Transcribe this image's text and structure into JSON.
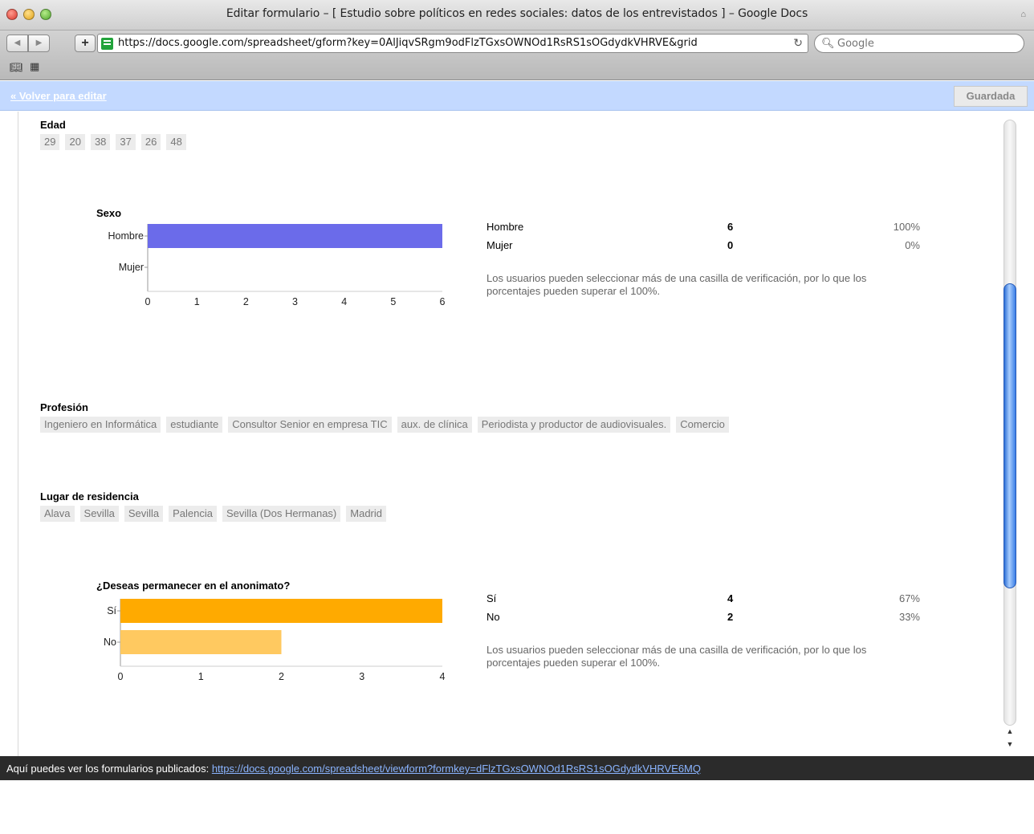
{
  "window": {
    "title": "Editar formulario – [ Estudio sobre políticos en redes sociales: datos de los entrevistados ] – Google Docs",
    "url": "https://docs.google.com/spreadsheet/gform?key=0AlJiqvSRgm9odFlzTGxsOWNOd1RsRS1sOGdydkVHRVE&grid",
    "search_placeholder": "Google",
    "icons": {
      "close": "close-light",
      "minimize": "minimize-light",
      "maximize": "maximize-light",
      "lock": "lock-icon",
      "reload": "reload-icon",
      "search": "search-icon",
      "bookmarks": "book-icon",
      "top_sites": "grid-icon"
    }
  },
  "appbar": {
    "back_link": "« Volver para editar",
    "saved_label": "Guardada",
    "color": "#c3d9ff"
  },
  "sections": {
    "edad": {
      "title": "Edad",
      "values": [
        "29",
        "20",
        "38",
        "37",
        "26",
        "48"
      ]
    },
    "profesion": {
      "title": "Profesión",
      "values": [
        "Ingeniero en Informática",
        "estudiante",
        "Consultor Senior en empresa TIC",
        "aux. de clínica",
        "Periodista y productor de audiovisuales.",
        "Comercio"
      ]
    },
    "residencia": {
      "title": "Lugar de residencia",
      "values": [
        "Alava",
        "Sevilla",
        "Sevilla",
        "Palencia",
        "Sevilla (Dos Hermanas)",
        "Madrid"
      ]
    }
  },
  "summaries": {
    "sexo": {
      "rows": [
        {
          "label": "Hombre",
          "count": "6",
          "pct": "100%"
        },
        {
          "label": "Mujer",
          "count": "0",
          "pct": "0%"
        }
      ],
      "note": "Los usuarios pueden seleccionar más de una casilla de verificación, por lo que los porcentajes pueden superar el 100%."
    },
    "anonimato": {
      "rows": [
        {
          "label": "Sí",
          "count": "4",
          "pct": "67%"
        },
        {
          "label": "No",
          "count": "2",
          "pct": "33%"
        }
      ],
      "note": "Los usuarios pueden seleccionar más de una casilla de verificación, por lo que los porcentajes pueden superar el 100%."
    }
  },
  "chart_data": [
    {
      "type": "bar",
      "orientation": "horizontal",
      "title": "Sexo",
      "categories": [
        "Hombre",
        "Mujer"
      ],
      "values": [
        6,
        0
      ],
      "colors": [
        "#6b6bea",
        "#6b6bea"
      ],
      "xlim": [
        0,
        6
      ],
      "ticks": [
        "0",
        "1",
        "2",
        "3",
        "4",
        "5",
        "6"
      ],
      "grid": false
    },
    {
      "type": "bar",
      "orientation": "horizontal",
      "title": "¿Deseas permanecer en el anonimato?",
      "categories": [
        "Sí",
        "No"
      ],
      "values": [
        4,
        2
      ],
      "colors": [
        "#ffaa00",
        "#ffc960"
      ],
      "xlim": [
        0,
        4
      ],
      "ticks": [
        "0",
        "1",
        "2",
        "3",
        "4"
      ],
      "grid": false
    }
  ],
  "footer": {
    "text": "Aquí puedes ver los formularios publicados:",
    "link": "https://docs.google.com/spreadsheet/viewform?formkey=dFlzTGxsOWNOd1RsRS1sOGdydkVHRVE6MQ"
  }
}
